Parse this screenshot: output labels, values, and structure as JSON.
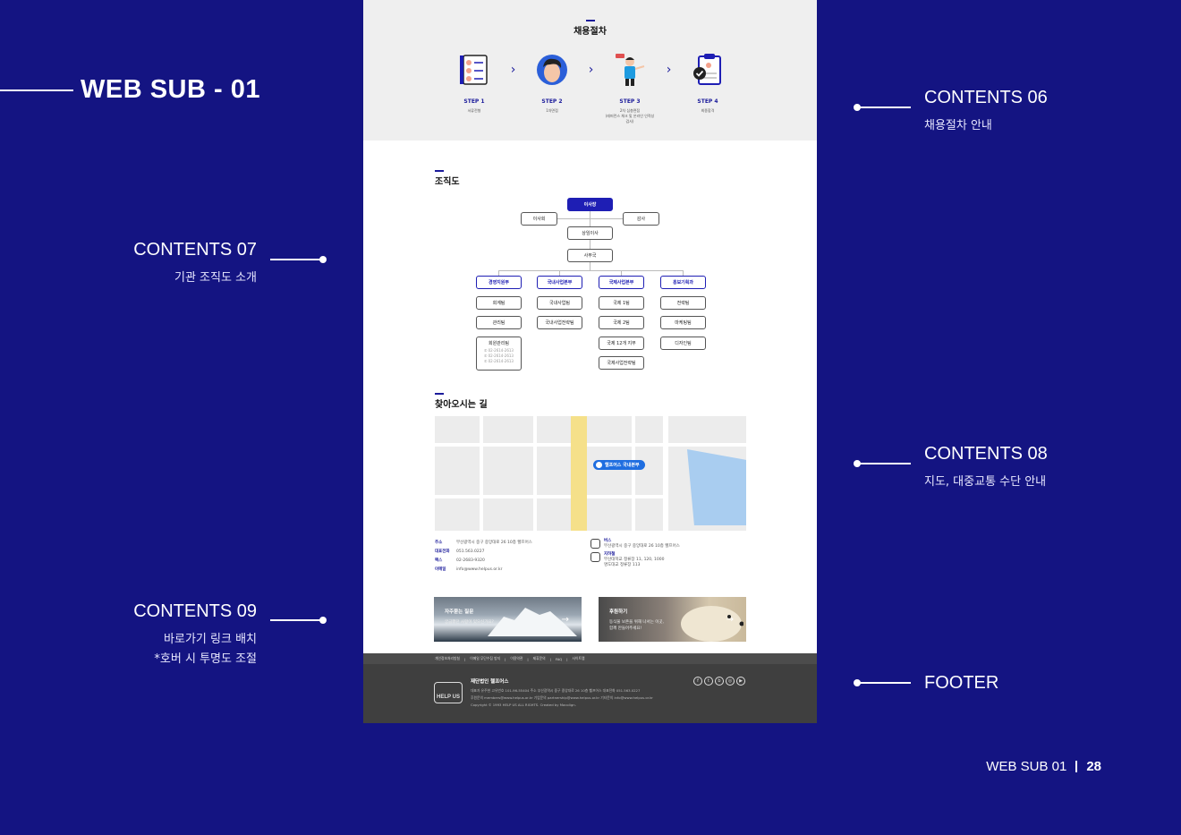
{
  "slide": {
    "title": "WEB SUB - 01",
    "page_label": "WEB SUB 01",
    "page_number": "28"
  },
  "annotations": {
    "c06": {
      "title": "CONTENTS 06",
      "desc": "채용절차 안내"
    },
    "c07": {
      "title": "CONTENTS 07",
      "desc": "기관 조직도 소개"
    },
    "c08": {
      "title": "CONTENTS 08",
      "desc": "지도, 대중교통 수단 안내"
    },
    "c09": {
      "title": "CONTENTS 09",
      "desc1": "바로가기 링크 배치",
      "desc2": "*호버 시 투명도 조절"
    },
    "footer": {
      "title": "FOOTER"
    }
  },
  "recruit": {
    "title": "채용절차",
    "steps": [
      {
        "label": "STEP 1",
        "desc": "서류전형",
        "icon": "resume-icon"
      },
      {
        "label": "STEP 2",
        "desc": "1차면접",
        "icon": "interviewer-icon"
      },
      {
        "label": "STEP 3",
        "desc": "2차 심층면접",
        "desc2": "(레퍼런스 체크 및 온라인 인적성 검사)",
        "icon": "presenter-icon"
      },
      {
        "label": "STEP 4",
        "desc": "최종합격",
        "icon": "clipboard-check-icon"
      }
    ]
  },
  "org": {
    "title": "조직도",
    "chair": "이사장",
    "board": "이사회",
    "auditor": "감사",
    "director": "상임이사",
    "office": "사무국",
    "depts": [
      {
        "name": "경영지원부",
        "teams": [
          "회계팀",
          "관리팀",
          "회원관리팀"
        ]
      },
      {
        "name": "국내사업본부",
        "teams": [
          "국내사업팀",
          "국내사업전략팀"
        ]
      },
      {
        "name": "국제사업본부",
        "teams": [
          "국제 1팀",
          "국제 2팀",
          "국제 12개 지부",
          "국제사업전략팀"
        ]
      },
      {
        "name": "홍보기획과",
        "teams": [
          "전략팀",
          "마케팅팀",
          "디자인팀"
        ]
      }
    ],
    "phones": [
      "02-2614-2613",
      "02-2614-2613",
      "02-2614-2613"
    ]
  },
  "location": {
    "title": "찾아오시는 길",
    "pin_label": "헬프어스 국내본부",
    "info": [
      {
        "k": "주소",
        "v": "부산광역시 중구 중앙대로 26 10층 헬프어스"
      },
      {
        "k": "대표전화",
        "v": "051.563.0227"
      },
      {
        "k": "팩스",
        "v": "02-2683-9320"
      },
      {
        "k": "이메일",
        "v": "info@www.helpus.or.kr"
      }
    ],
    "bus": {
      "title": "버스",
      "desc": "부산광역시 중구 중앙대로 26 10층 헬프어스"
    },
    "subway": {
      "title": "지하철",
      "desc": "부산대학교 정류장 11, 120, 1000",
      "desc2": "명도대교 정류장 113"
    }
  },
  "quicklinks": [
    {
      "title": "자주묻는 질문",
      "desc": "궁금했던 사항이 있으신가요?"
    },
    {
      "title": "후원하기",
      "desc": "동식물 보존을 위해 나서는 이곳,",
      "desc2": "함께 만들어주세요!"
    }
  ],
  "footer": {
    "nav": [
      "개인정보처리방침",
      "이메일 무단수집 방지",
      "이용약관",
      "제휴문의",
      "FAQ",
      "사이트맵"
    ],
    "org_name": "재단법인 헬프어스",
    "logo_text": "HELP US",
    "line1": "대표자 유주현   고유번호 101-96-55404   주소 부산광역시 중구 중앙대로 26 10층 헬프어스   대표전화 051.563.0227",
    "line2": "후원문의 members@www.helpus.or.kr   기업문의 partnership@www.helpus.or.kr   기타문의 info@www.helpus.or.kr",
    "copyright": "Copyright © 1993 HELP US ALL RIGHTS. Created by Macolign."
  },
  "colors": {
    "background": "#141482",
    "accent": "#1e1eb4",
    "footer": "#3f3f3f"
  }
}
